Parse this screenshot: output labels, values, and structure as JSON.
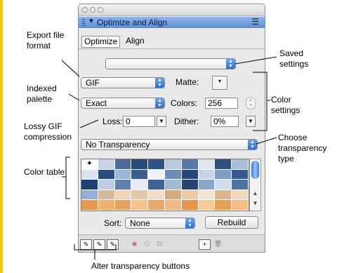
{
  "panel": {
    "title": "Optimize and Align",
    "tabs": [
      "Optimize",
      "Align"
    ],
    "saved_settings_value": "",
    "format": "GIF",
    "palette": "Exact",
    "matte_label": "Matte:",
    "colors_label": "Colors:",
    "colors_value": "256",
    "loss_label": "Loss:",
    "loss_value": "0",
    "dither_label": "Dither:",
    "dither_value": "0%",
    "transparency": "No Transparency",
    "sort_label": "Sort:",
    "sort_value": "None",
    "rebuild_label": "Rebuild",
    "color_rows": [
      [
        "#ffffff",
        "#c8d4e6",
        "#4a6b98",
        "#27497a",
        "#2d5488",
        "#b9c9e0",
        "#5a7aa6",
        "#dfe6f1",
        "#2f4f7f",
        "#a9bcd8"
      ],
      [
        "#d9e2ef",
        "#2c4c7c",
        "#9fb4d3",
        "#3b5e8f",
        "#f0f3f8",
        "#6e8db6",
        "#284677",
        "#c5d3e7",
        "#7e9bc1",
        "#365a8c"
      ],
      [
        "#1e3f72",
        "#bfcde3",
        "#5d80ad",
        "#e7ecf4",
        "#3f6397",
        "#a4b9d6",
        "#264573",
        "#8ba5c9",
        "#d2dcec",
        "#4f73a4"
      ],
      [
        "#94aed0",
        "#d7b89a",
        "#f0d4ba",
        "#e6c6a5",
        "#f3dcc6",
        "#d9a878",
        "#eccaa8",
        "#f6e4d3",
        "#dcb48e",
        "#f1d7bd"
      ],
      [
        "#e79a4e",
        "#f0b070",
        "#e8a35f",
        "#f5c28a",
        "#eca866",
        "#f2b981",
        "#e59449",
        "#f7cb98",
        "#ea9f58",
        "#f4bd85"
      ]
    ]
  },
  "callouts": {
    "export_format": "Export file format",
    "saved_settings": "Saved settings",
    "indexed_palette": "Indexed palette",
    "color_settings": "Color settings",
    "lossy_gif": "Lossy GIF compression",
    "choose_transparency": "Choose transparency type",
    "color_table": "Color table",
    "alter_transparency": "Alter transparency buttons"
  }
}
